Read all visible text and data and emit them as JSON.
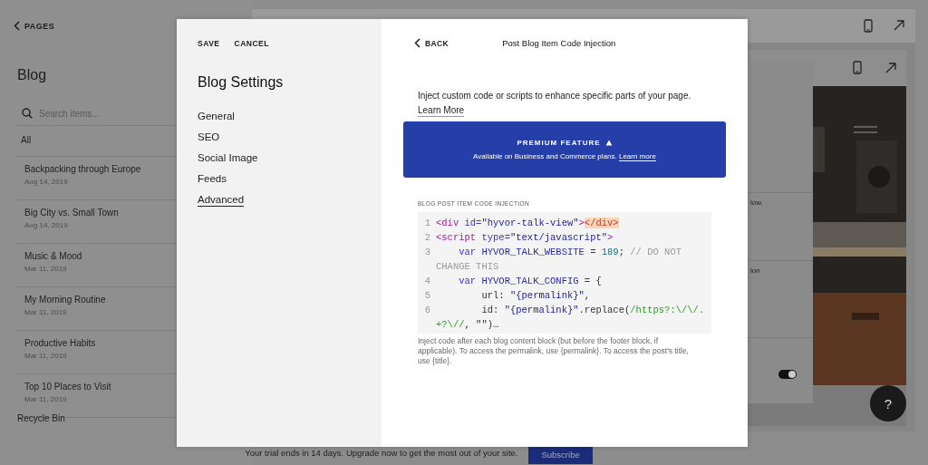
{
  "sidebar": {
    "back_link": "PAGES",
    "title": "Blog",
    "search": {
      "placeholder": "Search items..."
    },
    "filter": "All",
    "items": [
      {
        "title": "Backpacking through Europe",
        "date": "Aug 14, 2019"
      },
      {
        "title": "Big City vs. Small Town",
        "date": "Aug 14, 2019"
      },
      {
        "title": "Music & Mood",
        "date": "Mar 11, 2019"
      },
      {
        "title": "My Morning Routine",
        "date": "Mar 11, 2019"
      },
      {
        "title": "Productive Habits",
        "date": "Mar 11, 2019"
      },
      {
        "title": "Top 10 Places to Visit",
        "date": "Mar 11, 2019"
      }
    ],
    "recycle_bin": "Recycle Bin"
  },
  "preview": {
    "panel_texts": [
      "low.",
      "ion"
    ],
    "toggle": {
      "on": true
    },
    "help_button": "?"
  },
  "modal": {
    "actions": [
      "SAVE",
      "CANCEL"
    ],
    "title": "Blog Settings",
    "nav": [
      {
        "label": "General",
        "selected": false
      },
      {
        "label": "SEO",
        "selected": false
      },
      {
        "label": "Social Image",
        "selected": false
      },
      {
        "label": "Feeds",
        "selected": false
      },
      {
        "label": "Advanced",
        "selected": true
      }
    ],
    "back": "BACK",
    "panel_title": "Post Blog Item Code Injection",
    "intro": "Inject custom code or scripts to enhance specific parts of your page.",
    "intro_link": "Learn More",
    "premium": {
      "title": "PREMIUM FEATURE",
      "text": "Available on Business and Commerce plans.",
      "link": "Learn more"
    },
    "code_label": "BLOG POST ITEM CODE INJECTION",
    "code_lines": [
      {
        "number": "1",
        "tokens": [
          {
            "text": "<div ",
            "kind": "tag"
          },
          {
            "text": "id=",
            "kind": "attr"
          },
          {
            "text": "\"hyvor-talk-view\"",
            "kind": "string"
          },
          {
            "text": ">",
            "kind": "tag"
          },
          {
            "text": "</div>",
            "kind": "match"
          }
        ]
      },
      {
        "number": "2",
        "tokens": [
          {
            "text": "<script ",
            "kind": "tag"
          },
          {
            "text": "type=",
            "kind": "attr"
          },
          {
            "text": "\"text/javascript\"",
            "kind": "string"
          },
          {
            "text": ">",
            "kind": "tag"
          }
        ]
      },
      {
        "number": "3",
        "tokens": [
          {
            "text": "    var ",
            "kind": "keyword"
          },
          {
            "text": "HYVOR_TALK_WEBSITE",
            "kind": "variable"
          },
          {
            "text": " = ",
            "kind": "plain"
          },
          {
            "text": "189",
            "kind": "number"
          },
          {
            "text": "; ",
            "kind": "plain"
          },
          {
            "text": "// DO NOT CHANGE THIS",
            "kind": "comment"
          }
        ]
      },
      {
        "number": "4",
        "tokens": [
          {
            "text": "    var ",
            "kind": "keyword"
          },
          {
            "text": "HYVOR_TALK_CONFIG",
            "kind": "variable"
          },
          {
            "text": " = {",
            "kind": "plain"
          }
        ]
      },
      {
        "number": "5",
        "tokens": [
          {
            "text": "        url: ",
            "kind": "plain"
          },
          {
            "text": "\"{permalink}\"",
            "kind": "string"
          },
          {
            "text": ",",
            "kind": "plain"
          }
        ]
      },
      {
        "number": "6",
        "tokens": [
          {
            "text": "        id: ",
            "kind": "plain"
          },
          {
            "text": "\"{permalink}\"",
            "kind": "string"
          },
          {
            "text": ".replace(",
            "kind": "plain"
          },
          {
            "text": "/https?:\\/\\/.+?\\//",
            "kind": "regex"
          },
          {
            "text": ", \"\")…",
            "kind": "plain"
          }
        ]
      }
    ],
    "help_text": "Inject code after each blog content block (but before the footer block, if applicable). To access the permalink, use {permalink}. To access the post's title, use {title}."
  },
  "trial_bar": {
    "text": "Your trial ends in 14 days. Upgrade now to get the most out of your site.",
    "button": "Subscribe"
  }
}
